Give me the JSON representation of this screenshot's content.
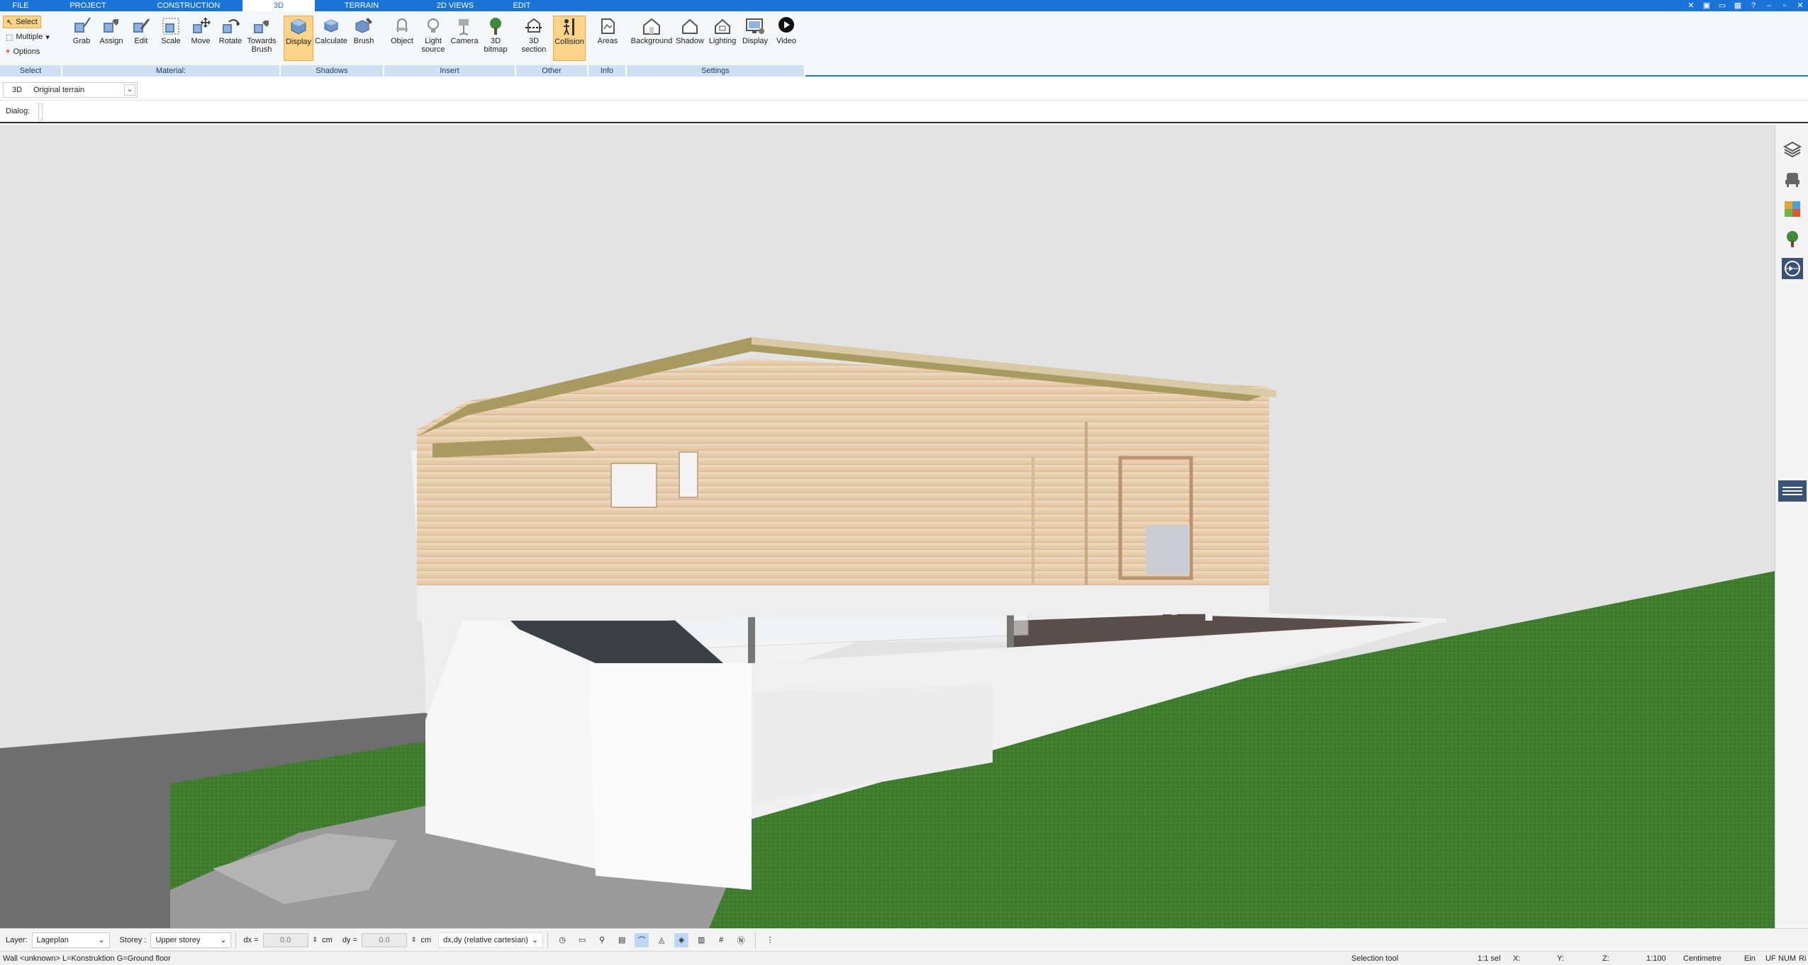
{
  "tabs": [
    {
      "label": "FILE",
      "active": false
    },
    {
      "label": "PROJECT",
      "active": false
    },
    {
      "label": "CONSTRUCTION",
      "active": false
    },
    {
      "label": "3D",
      "active": true
    },
    {
      "label": "TERRAIN",
      "active": false
    },
    {
      "label": "2D VIEWS",
      "active": false
    },
    {
      "label": "EDIT",
      "active": false
    }
  ],
  "ribbon": {
    "select_group": {
      "select": "Select",
      "multiple": "Multiple",
      "options": "Options",
      "label": "Select"
    },
    "material_group": {
      "label": "Material:",
      "buttons": [
        {
          "label": "Grab",
          "icon": "grab-icon"
        },
        {
          "label": "Assign",
          "icon": "assign-icon"
        },
        {
          "label": "Edit",
          "icon": "edit-icon"
        },
        {
          "label": "Scale",
          "icon": "scale-icon"
        },
        {
          "label": "Move",
          "icon": "move-icon"
        },
        {
          "label": "Rotate",
          "icon": "rotate-icon"
        },
        {
          "label": "Towards Brush",
          "icon": "towards-brush-icon"
        }
      ]
    },
    "shadows_group": {
      "label": "Shadows",
      "buttons": [
        {
          "label": "Display",
          "icon": "display-shadows-icon",
          "active": true
        },
        {
          "label": "Calculate",
          "icon": "calculate-icon"
        },
        {
          "label": "Brush",
          "icon": "brush-icon"
        }
      ]
    },
    "insert_group": {
      "label": "Insert",
      "buttons": [
        {
          "label": "Object",
          "icon": "object-icon"
        },
        {
          "label": "Light source",
          "icon": "light-source-icon"
        },
        {
          "label": "Camera",
          "icon": "camera-icon"
        },
        {
          "label": "3D bitmap",
          "icon": "tree-bitmap-icon"
        }
      ]
    },
    "other_group": {
      "label": "Other",
      "buttons": [
        {
          "label": "3D section",
          "icon": "section-icon"
        },
        {
          "label": "Collision",
          "icon": "collision-icon",
          "active": true
        }
      ]
    },
    "info_group": {
      "label": "Info",
      "buttons": [
        {
          "label": "Areas",
          "icon": "areas-icon"
        }
      ]
    },
    "settings_group": {
      "label": "Settings",
      "buttons": [
        {
          "label": "Background",
          "icon": "background-icon"
        },
        {
          "label": "Shadow",
          "icon": "shadow-icon"
        },
        {
          "label": "Lighting",
          "icon": "lighting-icon"
        },
        {
          "label": "Display",
          "icon": "display-icon"
        },
        {
          "label": "Video",
          "icon": "video-icon"
        }
      ]
    }
  },
  "viewbar": {
    "mode": "3D",
    "view": "Original terrain"
  },
  "dialogbar": {
    "label": "Dialog:"
  },
  "bottombar": {
    "layer_label": "Layer:",
    "layer_value": "Lageplan",
    "storey_label": "Storey :",
    "storey_value": "Upper storey",
    "dx_label": "dx =",
    "dx_value": "0.0",
    "dx_unit": "cm",
    "dy_label": "dy =",
    "dy_value": "0.0",
    "dy_unit": "cm",
    "coord_mode": "dx,dy (relative cartesian)"
  },
  "statusbar": {
    "message": "Wall <unknown> L=Konstruktion G=Ground floor",
    "tool": "Selection tool",
    "sel": "1:1 sel",
    "x": "X:",
    "y": "Y:",
    "z": "Z:",
    "scale": "1:100",
    "unit": "Centimetre",
    "ein": "Ein",
    "uf": "UF",
    "num": "NUM",
    "ri": "Ri"
  },
  "colors": {
    "accent": "#1a73d6",
    "active_button": "#fbd489",
    "group_label_bg": "#cfe0f3",
    "grass": "#3f7d2e",
    "wood": "#e5cdb0",
    "sky": "#e3e3e3"
  }
}
